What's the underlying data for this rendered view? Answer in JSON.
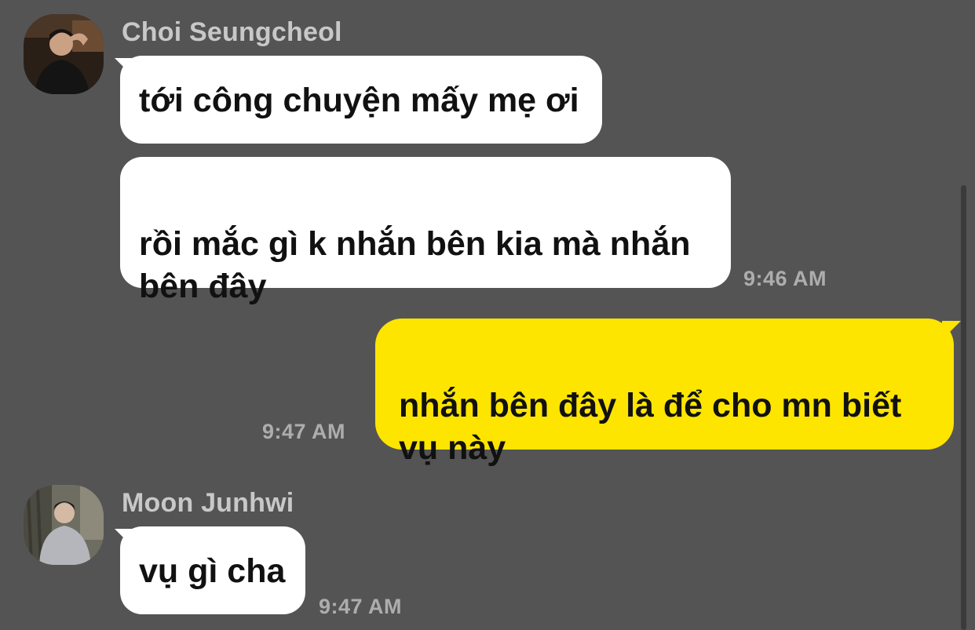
{
  "messages": [
    {
      "sender": "Choi Seungcheol",
      "avatar_icon": "profile-photo-man-dark-shirt",
      "bubbles": [
        "tới công chuyện mấy mẹ ơi",
        "rồi mắc gì k nhắn bên kia mà nhắn\nbên đây"
      ],
      "time": "9:46 AM"
    },
    {
      "sender": "me",
      "bubbles": [
        "nhắn bên đây là để cho mn biết\nvụ này"
      ],
      "time": "9:47 AM"
    },
    {
      "sender": "Moon Junhwi",
      "avatar_icon": "profile-photo-man-grey-hoodie",
      "bubbles": [
        "vụ gì cha"
      ],
      "time": "9:47 AM"
    }
  ],
  "colors": {
    "background": "#555455",
    "incoming_bubble": "#ffffff",
    "outgoing_bubble": "#fee500",
    "meta_text": "#aeadae"
  }
}
